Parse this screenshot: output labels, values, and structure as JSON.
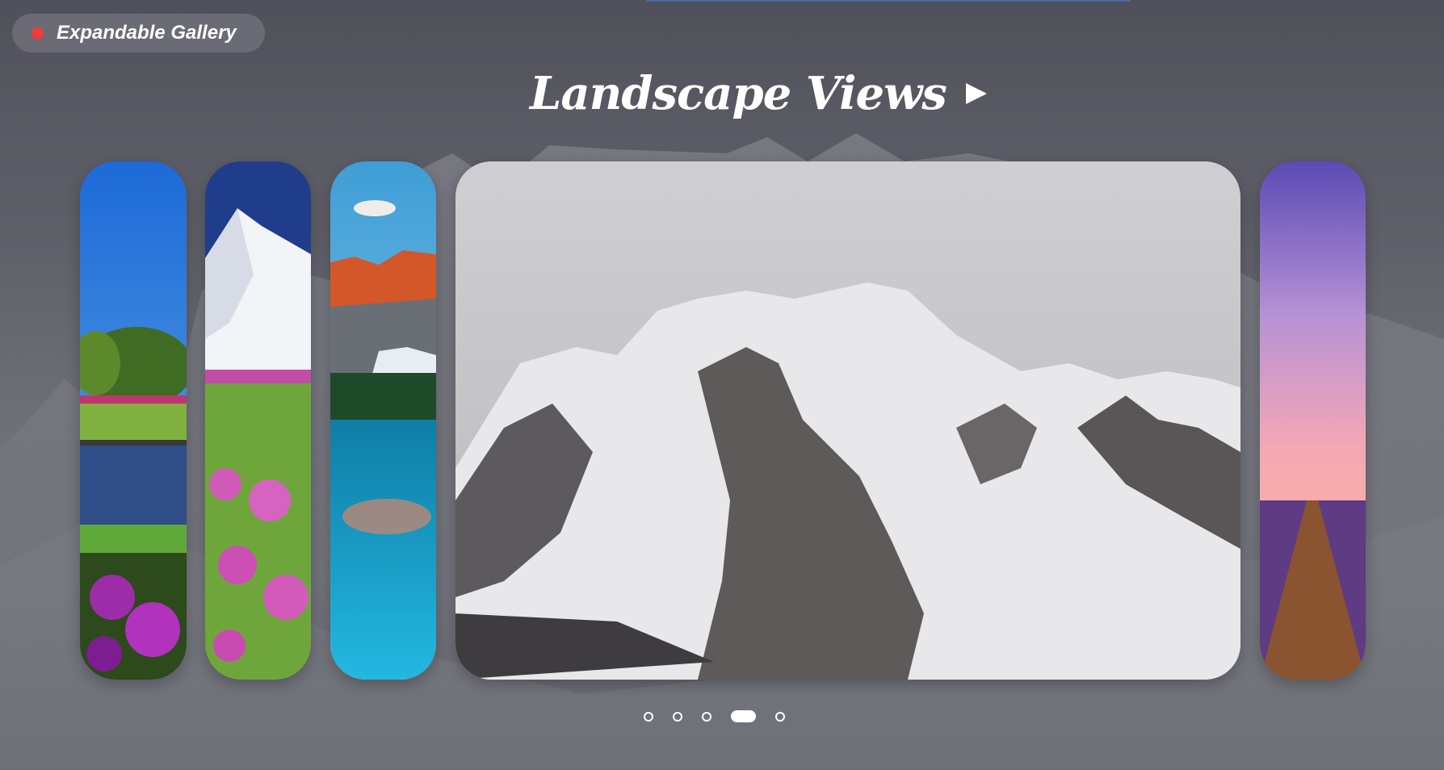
{
  "badge": {
    "label": "Expandable Gallery",
    "dot_color": "#ee3b3b"
  },
  "header": {
    "title": "Landscape Views"
  },
  "gallery": {
    "cards": [
      {
        "name": "card-meadow-bridge",
        "scene": "meadow with bridge, trees and purple flowers"
      },
      {
        "name": "card-snowy-peak-flowers",
        "scene": "snowy mountain peak above pink wildflower field"
      },
      {
        "name": "card-red-cliffs-lake",
        "scene": "red cliffs, pine forest and turquoise lake"
      },
      {
        "name": "card-snowy-mountains",
        "scene": "snow-covered rocky mountain range"
      },
      {
        "name": "card-lavender-sunset",
        "scene": "lavender field path under sunset sky"
      }
    ],
    "active_index": 3,
    "dot_count": 5
  }
}
